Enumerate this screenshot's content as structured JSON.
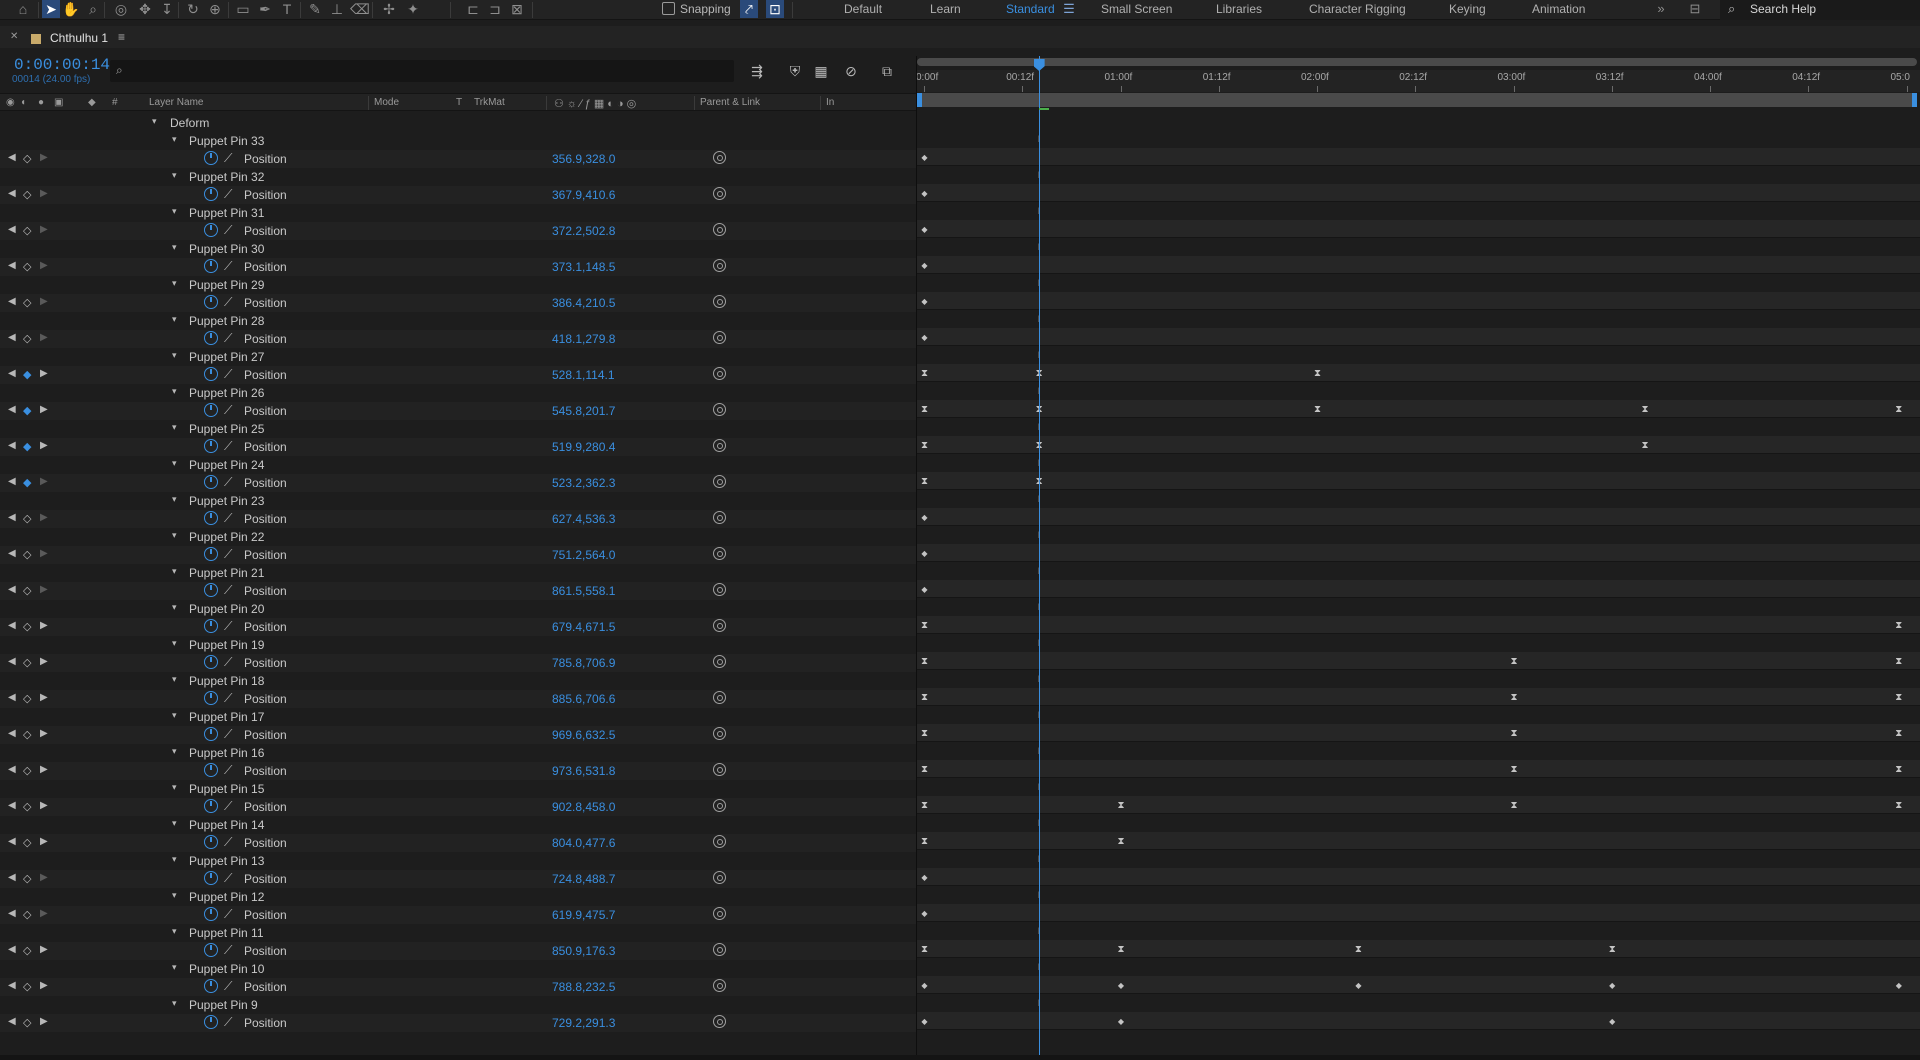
{
  "toolbar": {
    "snapping_label": "Snapping",
    "workspaces": [
      {
        "label": "Default",
        "active": false
      },
      {
        "label": "Learn",
        "active": false
      },
      {
        "label": "Standard",
        "active": true
      },
      {
        "label": "Small Screen",
        "active": false
      },
      {
        "label": "Libraries",
        "active": false
      },
      {
        "label": "Character Rigging",
        "active": false
      },
      {
        "label": "Keying",
        "active": false
      },
      {
        "label": "Animation",
        "active": false
      }
    ],
    "overflow_icon": "»",
    "search_label": "Search Help"
  },
  "panel": {
    "comp_name": "Chthulhu 1",
    "comp_color": "#c8aa6a"
  },
  "header": {
    "timecode": "0:00:00:14",
    "frame_info": "00014 (24.00 fps)"
  },
  "columns": {
    "layer_name": "Layer Name",
    "mode": "Mode",
    "t": "T",
    "trkmat": "TrkMat",
    "parent_link": "Parent & Link",
    "in": "In",
    "hash": "#"
  },
  "group": {
    "label": "Deform"
  },
  "pins": [
    {
      "name": "Puppet Pin 33",
      "prop": "Position",
      "value": "356.9,328.0",
      "nav": "none",
      "keys": [
        {
          "t": 0,
          "k": "diam"
        }
      ]
    },
    {
      "name": "Puppet Pin 32",
      "prop": "Position",
      "value": "367.9,410.6",
      "nav": "none",
      "keys": [
        {
          "t": 0,
          "k": "diam"
        }
      ]
    },
    {
      "name": "Puppet Pin 31",
      "prop": "Position",
      "value": "372.2,502.8",
      "nav": "none",
      "keys": [
        {
          "t": 0,
          "k": "diam"
        }
      ]
    },
    {
      "name": "Puppet Pin 30",
      "prop": "Position",
      "value": "373.1,148.5",
      "nav": "none",
      "keys": [
        {
          "t": 0,
          "k": "diam"
        }
      ]
    },
    {
      "name": "Puppet Pin 29",
      "prop": "Position",
      "value": "386.4,210.5",
      "nav": "none",
      "keys": [
        {
          "t": 0,
          "k": "diam"
        }
      ]
    },
    {
      "name": "Puppet Pin 28",
      "prop": "Position",
      "value": "418.1,279.8",
      "nav": "none",
      "keys": [
        {
          "t": 0,
          "k": "diam"
        }
      ]
    },
    {
      "name": "Puppet Pin 27",
      "prop": "Position",
      "value": "528.1,114.1",
      "nav": "on",
      "keys": [
        {
          "t": 0,
          "k": "hold"
        },
        {
          "t": 14,
          "k": "hold"
        },
        {
          "t": 48,
          "k": "hold"
        }
      ]
    },
    {
      "name": "Puppet Pin 26",
      "prop": "Position",
      "value": "545.8,201.7",
      "nav": "on",
      "keys": [
        {
          "t": 0,
          "k": "hold"
        },
        {
          "t": 14,
          "k": "hold"
        },
        {
          "t": 48,
          "k": "hold"
        },
        {
          "t": 88,
          "k": "hold"
        },
        {
          "t": 119,
          "k": "hold"
        }
      ]
    },
    {
      "name": "Puppet Pin 25",
      "prop": "Position",
      "value": "519.9,280.4",
      "nav": "on",
      "keys": [
        {
          "t": 0,
          "k": "hold"
        },
        {
          "t": 14,
          "k": "hold"
        },
        {
          "t": 88,
          "k": "hold"
        }
      ]
    },
    {
      "name": "Puppet Pin 24",
      "prop": "Position",
      "value": "523.2,362.3",
      "nav": "onprev",
      "keys": [
        {
          "t": 0,
          "k": "hold"
        },
        {
          "t": 14,
          "k": "hold"
        }
      ]
    },
    {
      "name": "Puppet Pin 23",
      "prop": "Position",
      "value": "627.4,536.3",
      "nav": "none",
      "keys": [
        {
          "t": 0,
          "k": "diam"
        }
      ]
    },
    {
      "name": "Puppet Pin 22",
      "prop": "Position",
      "value": "751.2,564.0",
      "nav": "none",
      "keys": [
        {
          "t": 0,
          "k": "diam"
        }
      ]
    },
    {
      "name": "Puppet Pin 21",
      "prop": "Position",
      "value": "861.5,558.1",
      "nav": "none",
      "keys": [
        {
          "t": 0,
          "k": "diam"
        }
      ]
    },
    {
      "name": "Puppet Pin 20",
      "prop": "Position",
      "value": "679.4,671.5",
      "nav": "next",
      "keys": [
        {
          "t": 0,
          "k": "hold"
        },
        {
          "t": 119,
          "k": "hold"
        }
      ]
    },
    {
      "name": "Puppet Pin 19",
      "prop": "Position",
      "value": "785.8,706.9",
      "nav": "next",
      "keys": [
        {
          "t": 0,
          "k": "hold"
        },
        {
          "t": 72,
          "k": "hold"
        },
        {
          "t": 119,
          "k": "hold"
        }
      ]
    },
    {
      "name": "Puppet Pin 18",
      "prop": "Position",
      "value": "885.6,706.6",
      "nav": "next",
      "keys": [
        {
          "t": 0,
          "k": "hold"
        },
        {
          "t": 72,
          "k": "hold"
        },
        {
          "t": 119,
          "k": "hold"
        }
      ]
    },
    {
      "name": "Puppet Pin 17",
      "prop": "Position",
      "value": "969.6,632.5",
      "nav": "next",
      "keys": [
        {
          "t": 0,
          "k": "hold"
        },
        {
          "t": 72,
          "k": "hold"
        },
        {
          "t": 119,
          "k": "hold"
        }
      ]
    },
    {
      "name": "Puppet Pin 16",
      "prop": "Position",
      "value": "973.6,531.8",
      "nav": "next",
      "keys": [
        {
          "t": 0,
          "k": "hold"
        },
        {
          "t": 72,
          "k": "hold"
        },
        {
          "t": 119,
          "k": "hold"
        }
      ]
    },
    {
      "name": "Puppet Pin 15",
      "prop": "Position",
      "value": "902.8,458.0",
      "nav": "next",
      "keys": [
        {
          "t": 0,
          "k": "hold"
        },
        {
          "t": 24,
          "k": "hold"
        },
        {
          "t": 72,
          "k": "hold"
        },
        {
          "t": 119,
          "k": "hold"
        }
      ]
    },
    {
      "name": "Puppet Pin 14",
      "prop": "Position",
      "value": "804.0,477.6",
      "nav": "next",
      "keys": [
        {
          "t": 0,
          "k": "hold"
        },
        {
          "t": 24,
          "k": "hold"
        }
      ]
    },
    {
      "name": "Puppet Pin 13",
      "prop": "Position",
      "value": "724.8,488.7",
      "nav": "none",
      "keys": [
        {
          "t": 0,
          "k": "diam"
        }
      ]
    },
    {
      "name": "Puppet Pin 12",
      "prop": "Position",
      "value": "619.9,475.7",
      "nav": "none",
      "keys": [
        {
          "t": 0,
          "k": "diam"
        }
      ]
    },
    {
      "name": "Puppet Pin 11",
      "prop": "Position",
      "value": "850.9,176.3",
      "nav": "next",
      "keys": [
        {
          "t": 0,
          "k": "hold"
        },
        {
          "t": 24,
          "k": "hold"
        },
        {
          "t": 53,
          "k": "hold"
        },
        {
          "t": 84,
          "k": "hold"
        }
      ]
    },
    {
      "name": "Puppet Pin 10",
      "prop": "Position",
      "value": "788.8,232.5",
      "nav": "next",
      "keys": [
        {
          "t": 0,
          "k": "diam"
        },
        {
          "t": 24,
          "k": "diam"
        },
        {
          "t": 53,
          "k": "diam"
        },
        {
          "t": 84,
          "k": "diam"
        },
        {
          "t": 119,
          "k": "diam"
        }
      ]
    },
    {
      "name": "Puppet Pin 9",
      "prop": "Position",
      "value": "729.2,291.3",
      "nav": "next",
      "keys": [
        {
          "t": 0,
          "k": "diam"
        },
        {
          "t": 24,
          "k": "diam"
        },
        {
          "t": 84,
          "k": "diam"
        }
      ]
    }
  ],
  "ruler": {
    "ticks": [
      "0:00f",
      "00:12f",
      "01:00f",
      "01:12f",
      "02:00f",
      "02:12f",
      "03:00f",
      "03:12f",
      "04:00f",
      "04:12f",
      "05:0"
    ],
    "fps": 24,
    "current_frame": 14
  }
}
